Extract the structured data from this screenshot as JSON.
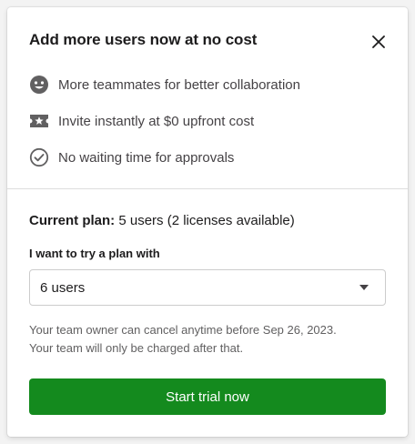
{
  "dialog": {
    "title": "Add more users now at no cost",
    "close_icon": "close-icon"
  },
  "benefits": [
    {
      "icon": "smiley-face-icon",
      "label": "More teammates for better collaboration"
    },
    {
      "icon": "ticket-star-icon",
      "label": "Invite instantly at $0 upfront cost"
    },
    {
      "icon": "check-circle-icon",
      "label": "No waiting time for approvals"
    }
  ],
  "plan": {
    "label": "Current plan:",
    "value": "5 users (2 licenses available)"
  },
  "select": {
    "label": "I want to try a plan with",
    "value": "6 users"
  },
  "note": {
    "line1": "Your team owner can cancel anytime before Sep 26, 2023.",
    "line2": "Your team will only be charged after that."
  },
  "cta": {
    "label": "Start trial now"
  },
  "colors": {
    "accent": "#148a1e",
    "icon": "#616061"
  }
}
